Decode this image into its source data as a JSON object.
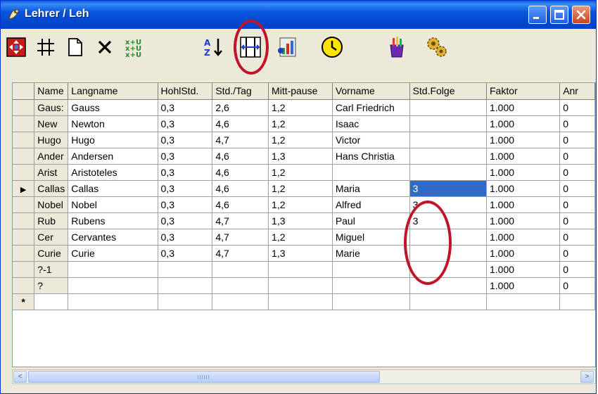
{
  "window": {
    "title": "Lehrer / Leh"
  },
  "toolbar": {
    "tools": [
      "teacher-dialog-icon",
      "grid-icon",
      "new-document-icon",
      "delete-icon",
      "sort-fields-icon",
      "sort-az-icon",
      "column-width-icon",
      "chart-icon",
      "clock-icon",
      "paint-icon",
      "gears-icon"
    ]
  },
  "grid": {
    "columns": [
      "Name",
      "Langname",
      "HohlStd.",
      "Std./Tag",
      "Mitt-pause",
      "Vorname",
      "Std.Folge",
      "Faktor",
      "Anr"
    ],
    "rows": [
      [
        "Gaus:",
        "Gauss",
        "0,3",
        "2,6",
        "1,2",
        "Carl Friedrich",
        "",
        "1.000",
        "0"
      ],
      [
        "New",
        "Newton",
        "0,3",
        "4,6",
        "1,2",
        "Isaac",
        "",
        "1.000",
        "0"
      ],
      [
        "Hugo",
        "Hugo",
        "0,3",
        "4,7",
        "1,2",
        "Victor",
        "",
        "1.000",
        "0"
      ],
      [
        "Ander",
        "Andersen",
        "0,3",
        "4,6",
        "1,3",
        "Hans Christia",
        "",
        "1.000",
        "0"
      ],
      [
        "Arist",
        "Aristoteles",
        "0,3",
        "4,6",
        "1,2",
        "",
        "",
        "1.000",
        "0"
      ],
      [
        "Callas",
        "Callas",
        "0,3",
        "4,6",
        "1,2",
        "Maria",
        "3",
        "1.000",
        "0"
      ],
      [
        "Nobel",
        "Nobel",
        "0,3",
        "4,6",
        "1,2",
        "Alfred",
        "3",
        "1.000",
        "0"
      ],
      [
        "Rub",
        "Rubens",
        "0,3",
        "4,7",
        "1,3",
        "Paul",
        "3",
        "1.000",
        "0"
      ],
      [
        "Cer",
        "Cervantes",
        "0,3",
        "4,7",
        "1,2",
        "Miguel",
        "",
        "1.000",
        "0"
      ],
      [
        "Curie",
        "Curie",
        "0,3",
        "4,7",
        "1,3",
        "Marie",
        "",
        "1.000",
        "0"
      ],
      [
        "?-1",
        "",
        "",
        "",
        "",
        "",
        "",
        "1.000",
        "0"
      ],
      [
        "?",
        "",
        "",
        "",
        "",
        "",
        "",
        "1.000",
        "0"
      ]
    ],
    "current_row_marker": "▶",
    "new_row_marker": "*"
  },
  "scrollbar": {
    "left": "<",
    "right": ">"
  }
}
